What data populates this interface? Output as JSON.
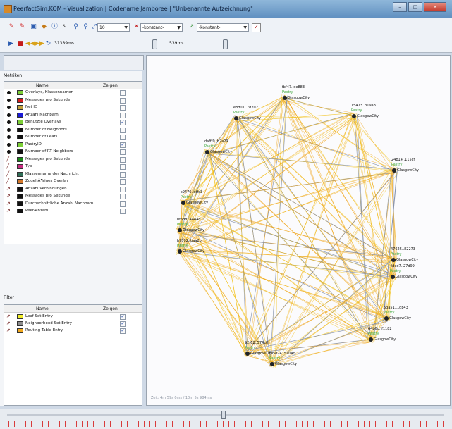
{
  "window": {
    "title": "PeerfactSim.KOM - Visualization | Codename Jamboree | \"Unbenannte Aufzeichnung\"",
    "buttons": {
      "minimize": "–",
      "maximize": "□",
      "close": "✕"
    }
  },
  "toolbar": {
    "icons": [
      "record-icon",
      "edit-icon",
      "save-icon",
      "pin-icon",
      "info-icon",
      "cursor-icon",
      "zoom-in-icon",
      "zoom-out-icon",
      "zoom-fit-icon"
    ],
    "zoom_value": "10",
    "combo1_value": "-konstant-",
    "combo2_value": "-konstant-",
    "play": {
      "elapsed": "31389ms",
      "speed": "539ms"
    }
  },
  "metrics_panel": {
    "title": "Metriken",
    "col_name": "Name",
    "col_show": "Zeigen",
    "rows": [
      {
        "kind": "dot",
        "color": "#7ccf36",
        "label": "Overlays, Klassennamen",
        "checked": false
      },
      {
        "kind": "dot",
        "color": "#d61b1b",
        "label": "Messages pro Sekunde",
        "checked": false
      },
      {
        "kind": "dot",
        "color": "#c2a13a",
        "label": "Net ID",
        "checked": false
      },
      {
        "kind": "dot",
        "color": "#1b1bd6",
        "label": "Anzahl Nachbarn",
        "checked": false
      },
      {
        "kind": "dot",
        "color": "#7ccf36",
        "label": "Benutzte Overlays",
        "checked": true
      },
      {
        "kind": "dot",
        "color": "#111111",
        "label": "Number of Neighbors",
        "checked": false
      },
      {
        "kind": "dot",
        "color": "#111111",
        "label": "Number of Leafs",
        "checked": false
      },
      {
        "kind": "dot",
        "color": "#7ccf36",
        "label": "PastryID",
        "checked": true
      },
      {
        "kind": "dot",
        "color": "#111111",
        "label": "Number of RT Neighbors",
        "checked": false
      },
      {
        "kind": "edge",
        "color": "#168a16",
        "label": "Messages pro Sekunde",
        "checked": false
      },
      {
        "kind": "edge",
        "color": "#c92d82",
        "label": "Typ",
        "checked": false
      },
      {
        "kind": "edge",
        "color": "#2f6e57",
        "label": "Klassenname der Nachricht",
        "checked": false
      },
      {
        "kind": "edge",
        "color": "#d5782a",
        "label": "ZugehÃ¶riges Overlay",
        "checked": false
      },
      {
        "kind": "multi",
        "color": "#111111",
        "label": "Anzahl Verbindungen",
        "checked": false
      },
      {
        "kind": "multi",
        "color": "#111111",
        "label": "Messages pro Sekunde",
        "checked": false
      },
      {
        "kind": "multi",
        "color": "#111111",
        "label": "Durchschnittliche Anzahl Nachbarn",
        "checked": false
      },
      {
        "kind": "multi",
        "color": "#111111",
        "label": "Peer-Anzahl",
        "checked": false
      }
    ]
  },
  "filter_panel": {
    "title": "Filter",
    "col_name": "Name",
    "col_show": "Zeigen",
    "rows": [
      {
        "color": "#f3ef2a",
        "label": "Leaf Set Entry",
        "checked": true
      },
      {
        "color": "#8c8c8c",
        "label": "Neighborhood Set Entry",
        "checked": true
      },
      {
        "color": "#f2a81d",
        "label": "Routing Table Entry",
        "checked": true
      }
    ]
  },
  "graph": {
    "status_text": "Zeit: 4m 59s 0ms / 10m 5s 984ms",
    "nodes": [
      {
        "id": "fbf47..de883",
        "status": "Pastry",
        "city": "GlasgowCity"
      },
      {
        "id": "15473..319a3",
        "status": "Pastry",
        "city": "GlasgowCity"
      },
      {
        "id": "e8d01..7d202",
        "status": "Pastry",
        "city": "GlasgowCity"
      },
      {
        "id": "dafff0..b2a29",
        "status": "Pastry",
        "city": "GlasgowCity"
      },
      {
        "id": "24b14..115cf",
        "status": "Pastry",
        "city": "GlasgowCity"
      },
      {
        "id": "c9476..effc3",
        "status": "Pastry",
        "city": "GlasgowCity"
      },
      {
        "id": "bf688..4444d",
        "status": "Pastry",
        "city": "GlasgowCity"
      },
      {
        "id": "b9702..baa2b",
        "status": "Pastry",
        "city": "GlasgowCity"
      },
      {
        "id": "47625..82273",
        "status": "Pastry",
        "city": "GlasgowCity"
      },
      {
        "id": "4ded7..27d99",
        "status": "Pastry",
        "city": "GlasgowCity"
      },
      {
        "id": "5ba51..1db43",
        "status": "Pastry",
        "city": "GlasgowCity"
      },
      {
        "id": "64b6d..f1182",
        "status": "Pastry",
        "city": "GlasgowCity"
      },
      {
        "id": "92f62..574c8",
        "status": "Pastry",
        "city": "GlasgowCity"
      },
      {
        "id": "f95d24..5704c",
        "status": "Pastry",
        "city": "GlasgowCity"
      }
    ],
    "colors": {
      "leaf": "#f2c21d",
      "route": "#f0a41a",
      "neighbor": "#7c8aa6"
    }
  }
}
